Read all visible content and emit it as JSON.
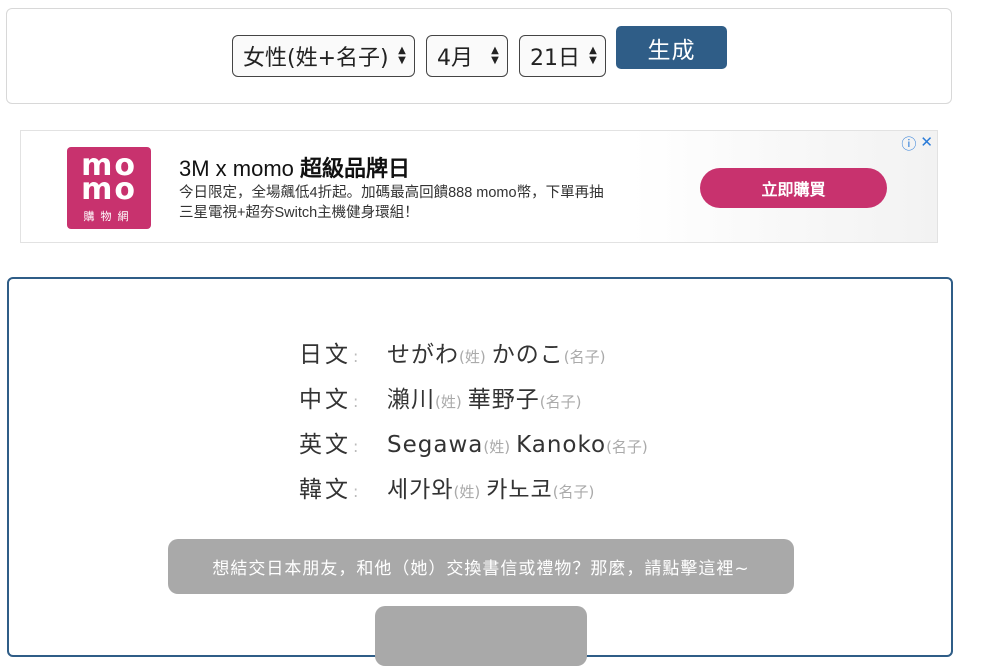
{
  "form": {
    "gender_select": "女性(姓+名子)",
    "month_select": "4月",
    "day_select": "21日",
    "generate_label": "生成"
  },
  "ad": {
    "logo_top": "mo",
    "logo_bottom": "mo",
    "logo_sub": "購物網",
    "title_prefix": "3M x momo ",
    "title_bold": "超級品牌日",
    "desc_line1": "今日限定，全場飆低4折起。加碼最高回饋888 momo幣，下單再抽",
    "desc_line2": "三星電視+超夯Switch主機健身環組！",
    "cta_label": "立即購買",
    "info_icon": "info-circle-icon",
    "close_icon": "close-icon",
    "accent_color": "#c8326e"
  },
  "result": {
    "rows": [
      {
        "lang": "日文",
        "surname": "せがわ",
        "surname_tag": "(姓)",
        "given": "かのこ",
        "given_tag": "(名子)"
      },
      {
        "lang": "中文",
        "surname": "瀨川",
        "surname_tag": "(姓)",
        "given": "華野子",
        "given_tag": "(名子)"
      },
      {
        "lang": "英文",
        "surname": "Segawa",
        "surname_tag": "(姓)",
        "given": "Kanoko",
        "given_tag": "(名子)"
      },
      {
        "lang": "韓文",
        "surname": "세가와",
        "surname_tag": "(姓)",
        "given": "카노코",
        "given_tag": "(名子)"
      }
    ],
    "colon": ":",
    "pill_text": "想結交日本朋友，和他（她）交換書信或禮物？那麼，請點擊這裡~"
  },
  "colors": {
    "primary": "#2f5d87",
    "pill_bg": "#a9a9a9"
  }
}
